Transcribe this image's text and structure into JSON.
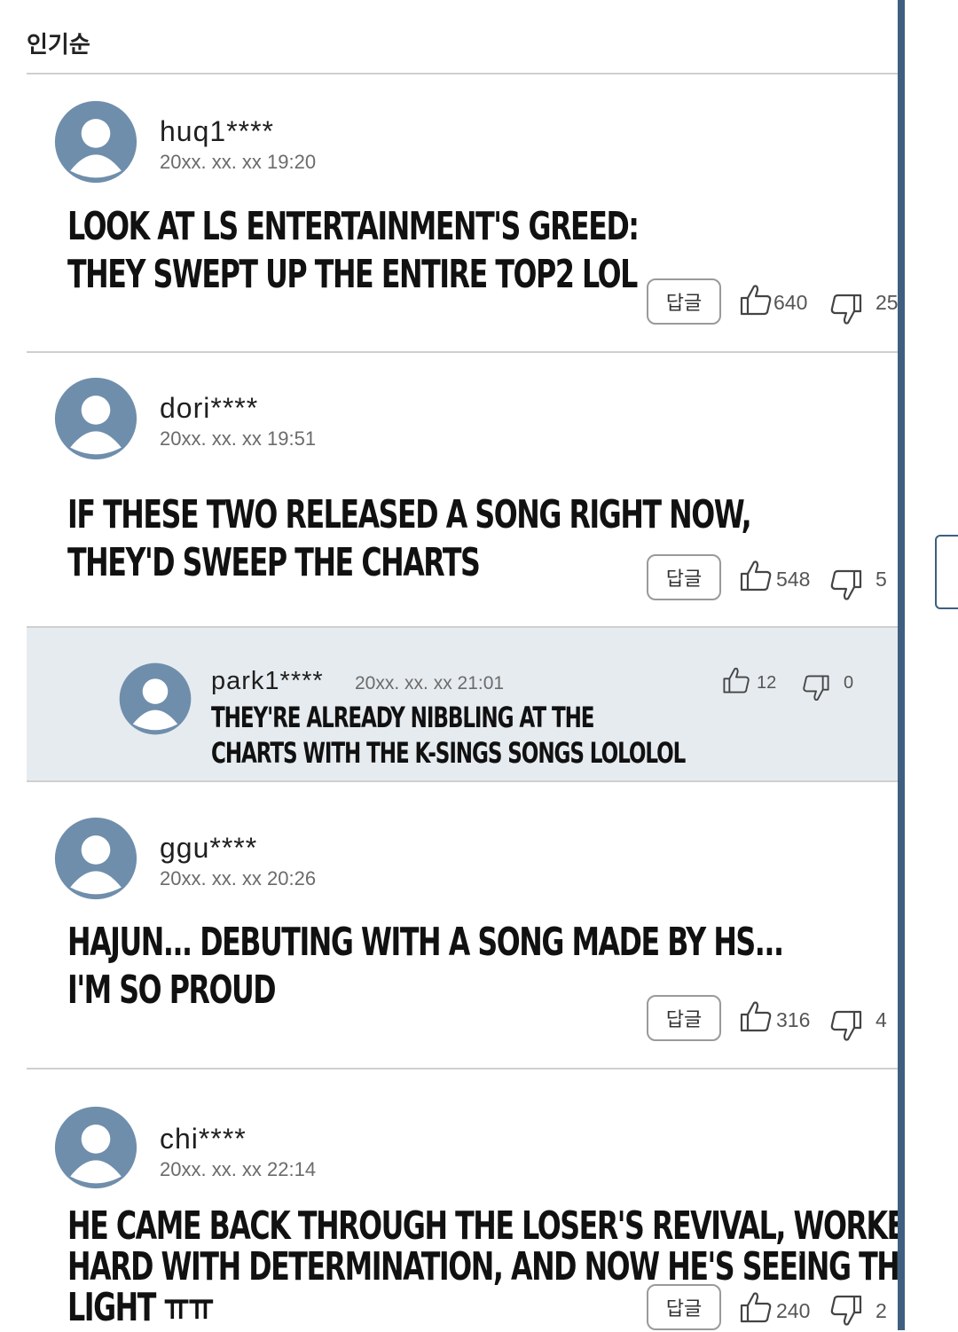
{
  "sort_label": "인기순",
  "reply_label": "답글",
  "comments": [
    {
      "user": "huq1****",
      "date": "20xx. xx. xx  19:20",
      "lines": [
        "LOOK AT LS ENTERTAINMENT'S GREED:",
        "THEY SWEPT UP THE ENTIRE TOP2 LOL"
      ],
      "likes": "640",
      "dislikes": "25"
    },
    {
      "user": "dori****",
      "date": "20xx. xx. xx  19:51",
      "lines": [
        "IF THESE TWO RELEASED A SONG RIGHT NOW,",
        "THEY'D SWEEP THE CHARTS"
      ],
      "likes": "548",
      "dislikes": "5"
    },
    {
      "user": "ggu****",
      "date": "20xx. xx. xx  20:26",
      "lines": [
        "HAJUN... DEBUTING WITH A SONG MADE BY HS...",
        "I'M SO PROUD"
      ],
      "likes": "316",
      "dislikes": "4"
    },
    {
      "user": "chi****",
      "date": "20xx. xx. xx  22:14",
      "lines": [
        "HE CAME BACK THROUGH THE LOSER'S REVIVAL, WORKED",
        "HARD WITH DETERMINATION, AND NOW HE'S SEEING THE",
        "LIGHT ㅠㅠ"
      ],
      "likes": "240",
      "dislikes": "2"
    }
  ],
  "reply": {
    "user": "park1****",
    "date": "20xx. xx. xx  21:01",
    "lines": [
      "THEY'RE ALREADY NIBBLING AT THE",
      "CHARTS WITH THE K-SINGS SONGS LOLOLOL"
    ],
    "likes": "12",
    "dislikes": "0"
  },
  "colors": {
    "avatar": "#6f8eac",
    "reply_background": "#e6ebef",
    "panel_border": "#3f5f80"
  }
}
